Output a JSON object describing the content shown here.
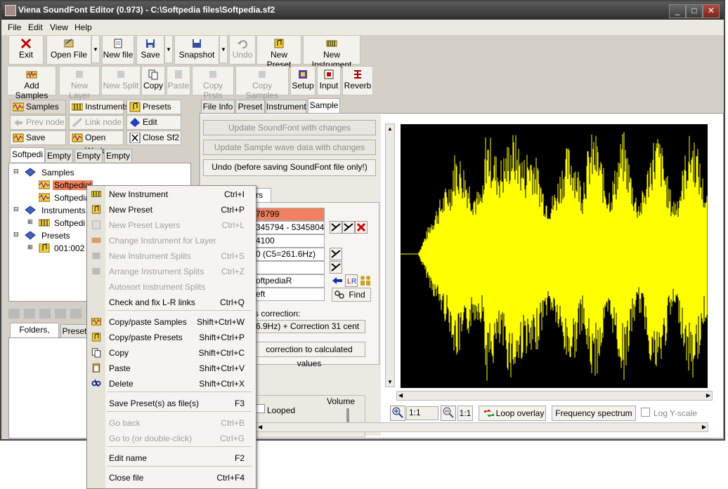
{
  "window": {
    "title": "Viena SoundFont Editor (0.973) - C:\\Softpedia files\\Softpedia.sf2",
    "minimize": "_",
    "maximize": "□",
    "close": "✕"
  },
  "menubar": [
    "File",
    "Edit",
    "View",
    "Help"
  ],
  "toolbar1": [
    {
      "label": "Exit",
      "icon": "exit-x-icon",
      "disabled": false
    },
    {
      "label": "Open File",
      "icon": "open-file-icon",
      "disabled": false
    },
    {
      "label": "New file",
      "icon": "new-file-icon",
      "disabled": false
    },
    {
      "label": "Save",
      "icon": "save-icon",
      "disabled": false
    },
    {
      "label": "Snapshot",
      "icon": "snapshot-icon",
      "disabled": false
    },
    {
      "label": "Undo",
      "icon": "undo-icon",
      "disabled": true
    },
    {
      "label": "New Preset",
      "icon": "new-preset-icon",
      "disabled": false
    },
    {
      "label": "New Instrument",
      "icon": "new-instrument-icon",
      "disabled": false
    }
  ],
  "toolbar2": [
    {
      "label": "Add Samples",
      "disabled": false
    },
    {
      "label": "New Layer",
      "disabled": true
    },
    {
      "label": "New Split",
      "disabled": true
    },
    {
      "label": "Copy",
      "disabled": false
    },
    {
      "label": "Paste",
      "disabled": true
    },
    {
      "label": "Copy Prsts",
      "disabled": true
    },
    {
      "label": "Copy Samples",
      "disabled": true
    },
    {
      "label": "Setup",
      "disabled": false
    },
    {
      "label": "Input",
      "disabled": false
    },
    {
      "label": "Reverb",
      "disabled": false
    }
  ],
  "sidebar_buttons": {
    "samples": "Samples",
    "instruments": "Instruments",
    "presets": "Presets",
    "prev_node": "Prev node",
    "link_node": "Link node",
    "edit_name": "Edit name",
    "save_work": "Save Work",
    "open_work": "Open Work",
    "close_sf2": "Close Sf2"
  },
  "file_tabs": [
    "Softpedi",
    "Empty",
    "Empty",
    "Empty"
  ],
  "tree": {
    "samples": "Samples",
    "sample_1": "Softpedial",
    "sample_2": "Softpedial",
    "instruments": "Instruments",
    "instrument_1": "Softpedi",
    "presets": "Presets",
    "preset_1": "001:002"
  },
  "lower_tabs": [
    "Folders, Files",
    "Preset"
  ],
  "context_menu": [
    {
      "label": "New Instrument",
      "shortcut": "Ctrl+I",
      "disabled": false
    },
    {
      "label": "New Preset",
      "shortcut": "Ctrl+P",
      "disabled": false
    },
    {
      "label": "New Preset Layers",
      "shortcut": "Ctrl+L",
      "disabled": true
    },
    {
      "label": "Change Instrument for Layer",
      "shortcut": "",
      "disabled": true
    },
    {
      "label": "New Instrument Splits",
      "shortcut": "Ctrl+S",
      "disabled": true
    },
    {
      "label": "Arrange Instrument Splits",
      "shortcut": "Ctrl+Z",
      "disabled": true
    },
    {
      "label": "Autosort Instrument Splits",
      "shortcut": "",
      "disabled": true
    },
    {
      "label": "Check and fix L-R links",
      "shortcut": "Ctrl+Q",
      "disabled": false
    },
    {
      "label": "Copy/paste Samples",
      "shortcut": "Shift+Ctrl+W",
      "disabled": false
    },
    {
      "label": "Copy/paste Presets",
      "shortcut": "Shift+Ctrl+P",
      "disabled": false
    },
    {
      "label": "Copy",
      "shortcut": "Shift+Ctrl+C",
      "disabled": false
    },
    {
      "label": "Paste",
      "shortcut": "Shift+Ctrl+V",
      "disabled": false
    },
    {
      "label": "Delete",
      "shortcut": "Shift+Ctrl+X",
      "disabled": false
    },
    {
      "label": "Save Preset(s) as file(s)",
      "shortcut": "F3",
      "disabled": false
    },
    {
      "label": "Go back",
      "shortcut": "Ctrl+B",
      "disabled": true
    },
    {
      "label": "Go to (or double-click)",
      "shortcut": "Ctrl+G",
      "disabled": true
    },
    {
      "label": "Edit name",
      "shortcut": "F2",
      "disabled": false
    },
    {
      "label": "Close file",
      "shortcut": "Ctrl+F4",
      "disabled": false
    }
  ],
  "editor_tabs": [
    "File Info",
    "Preset",
    "Instrument",
    "Sample"
  ],
  "sample_panel": {
    "update_sf": "Update SoundFont with changes",
    "update_wave": "Update Sample wave data with changes",
    "undo": "Undo (before saving SoundFont file only!)",
    "params_tab": "ters",
    "field_1": "78799",
    "field_2": "345794 - 5345804",
    "field_3": "4100",
    "field_4": "0 (C5=261.6Hz)",
    "field_5": "oftpediaR",
    "field_6": "eft",
    "find": "Find",
    "pitch_label": "s correction:",
    "pitch_value": "6.9Hz) + Correction 31 cent",
    "apply_btn": "correction to calculated  values",
    "looped": "Looped",
    "volume": "Volume"
  },
  "wave_toolbar": {
    "zoom_in_value": "1:1",
    "zoom_out_value": "1:1",
    "loop_overlay": "Loop overlay",
    "frequency_spectrum": "Frequency spectrum",
    "log_y_scale": "Log Y-scale"
  },
  "colors": {
    "waveform": "#ffff00",
    "wave_bg": "#000000",
    "selection": "#f08060"
  }
}
